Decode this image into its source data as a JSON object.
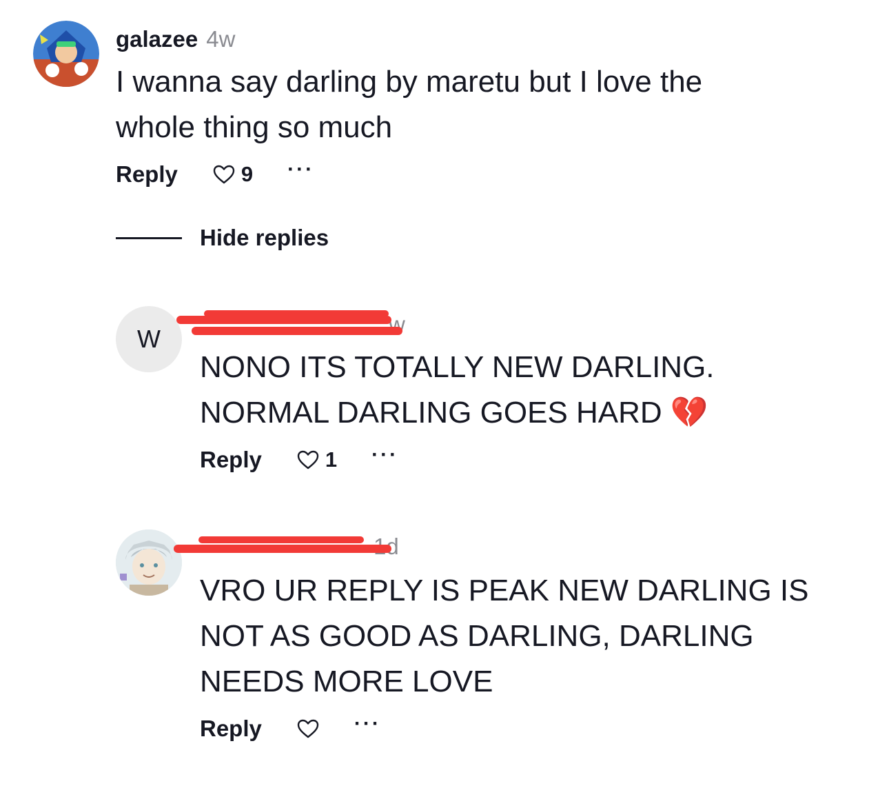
{
  "comments": [
    {
      "username": "galazee",
      "time": "4w",
      "text_lines": [
        "I wanna say darling by maretu but I love the",
        "whole thing so much"
      ],
      "reply_label": "Reply",
      "likes": "9",
      "more": "···"
    },
    {
      "avatar_letter": "W",
      "time": "w",
      "text_lines": [
        "NONO ITS TOTALLY NEW DARLING.",
        "NORMAL DARLING GOES HARD 💔"
      ],
      "reply_label": "Reply",
      "likes": "1",
      "more": "···"
    },
    {
      "time": "1d",
      "text_lines": [
        "VRO UR REPLY IS PEAK NEW DARLING IS",
        "NOT AS GOOD AS DARLING, DARLING",
        "NEEDS MORE LOVE"
      ],
      "reply_label": "Reply",
      "more": "···"
    }
  ],
  "replies_toggle": "Hide replies",
  "colors": {
    "text": "#161823",
    "muted": "#8a8b91",
    "redaction": "#f23a36"
  }
}
